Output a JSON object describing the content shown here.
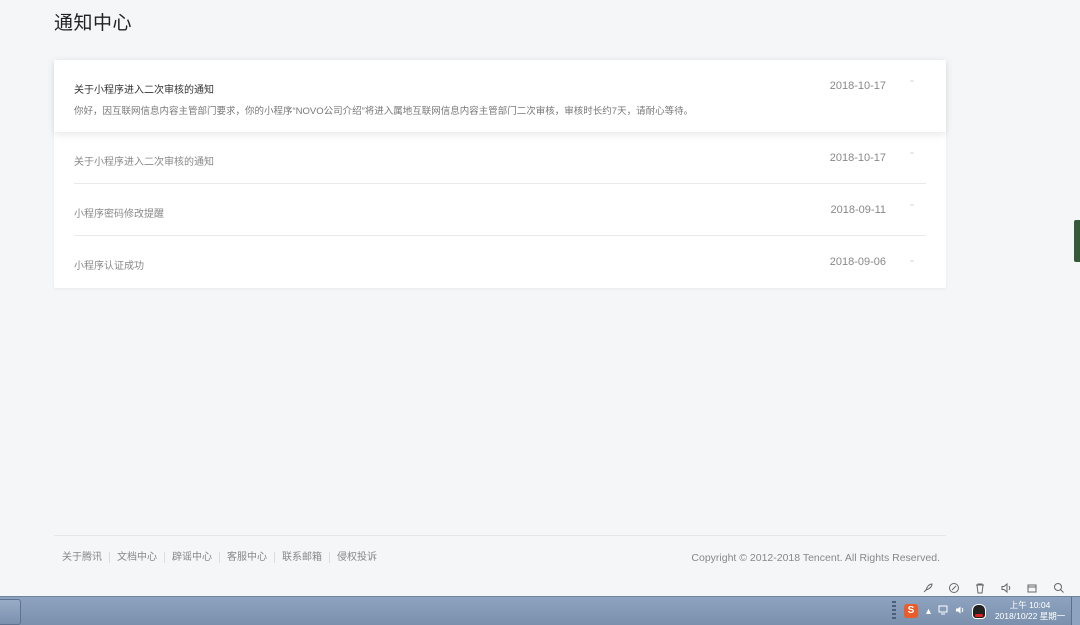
{
  "page": {
    "title": "通知中心"
  },
  "notices": [
    {
      "title": "关于小程序进入二次审核的通知",
      "date": "2018-10-17",
      "expanded": true,
      "content": "你好，因互联网信息内容主管部门要求，你的小程序“NOVO公司介绍”将进入属地互联网信息内容主管部门二次审核，审核时长约7天，请耐心等待。"
    },
    {
      "title": "关于小程序进入二次审核的通知",
      "date": "2018-10-17",
      "expanded": false
    },
    {
      "title": "小程序密码修改提醒",
      "date": "2018-09-11",
      "expanded": false
    },
    {
      "title": "小程序认证成功",
      "date": "2018-09-06",
      "expanded": false
    }
  ],
  "footer": {
    "links": [
      "关于腾讯",
      "文档中心",
      "辟谣中心",
      "客服中心",
      "联系邮箱",
      "侵权投诉"
    ],
    "copyright": "Copyright © 2012-2018 Tencent. All Rights Reserved."
  },
  "taskbar": {
    "clock_time": "上午 10:04",
    "clock_date": "2018/10/22 星期一",
    "tray_icons": [
      "sogou-input-icon",
      "tray-arrow-icon",
      "network-icon",
      "volume-icon",
      "qq-icon"
    ]
  },
  "top_tray_icons": [
    "rocket-icon",
    "clean-icon",
    "trash-icon",
    "speaker-icon",
    "window-icon",
    "search-icon"
  ],
  "colors": {
    "background": "#f5f6f8",
    "card": "#ffffff",
    "text_primary": "#333333",
    "text_secondary": "#888888",
    "taskbar": "#8ea3bf"
  }
}
